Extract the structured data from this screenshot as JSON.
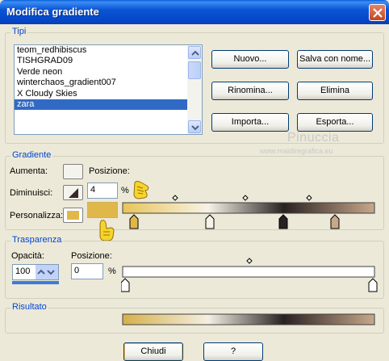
{
  "window": {
    "title": "Modifica gradiente"
  },
  "tipi": {
    "legend": "Tipi",
    "items": [
      "teom_redhibiscus",
      "TISHGRAD09",
      "Verde neon",
      "winterchaos_gradient007",
      "X Cloudy Skies",
      "zara"
    ],
    "selected_index": 5,
    "buttons": {
      "nuovo": "Nuovo...",
      "salva": "Salva con nome...",
      "rinomina": "Rinomina...",
      "elimina": "Elimina",
      "importa": "Importa...",
      "esporta": "Esporta..."
    }
  },
  "watermark": {
    "name": "Pinuccia",
    "url": "www.maidiregrafica.eu"
  },
  "gradiente": {
    "legend": "Gradiente",
    "aumenta": "Aumenta:",
    "diminuisci": "Diminuisci:",
    "personalizza": "Personalizza:",
    "posizione_label": "Posizione:",
    "posizione_value": "4",
    "percent": "%",
    "current_color": "#e0b84a",
    "stop_colors": [
      "#e0b84a",
      "#f7f2e6",
      "#2a2222",
      "#c8a88a"
    ]
  },
  "trasparenza": {
    "legend": "Trasparenza",
    "opacita_label": "Opacità:",
    "opacita_value": "100",
    "posizione_label": "Posizione:",
    "posizione_value": "0",
    "percent": "%"
  },
  "risultato": {
    "legend": "Risultato"
  },
  "footer": {
    "chiudi": "Chiudi",
    "help": "?"
  }
}
